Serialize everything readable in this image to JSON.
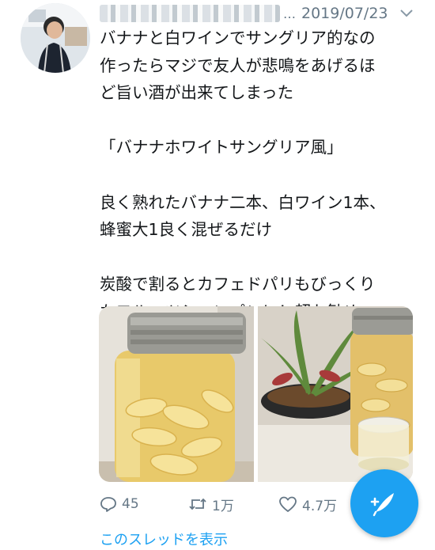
{
  "tweet": {
    "date": "2019/07/23",
    "header_more": "…",
    "text": "バナナと白ワインでサングリア的なの\n作ったらマジで友人が悲鳴をあげるほ\nど旨い酒が出来てしまった\n\n「バナナホワイトサングリア風」\n\n良く熟れたバナナ二本、白ワイン1本、\n蜂蜜大1良く混ぜるだけ\n\n炭酸で割るとカフェドパリもびっくり\nなフルーツシャンパンに！超お勧め"
  },
  "actions": {
    "reply_count": "45",
    "retweet_count": "1万",
    "like_count": "4.7万"
  },
  "thread_link": "このスレッドを表示",
  "icons": {
    "reply": "reply-icon",
    "retweet": "retweet-icon",
    "like": "heart-icon",
    "compose": "compose-tweet-icon",
    "menu": "chevron-down-icon"
  },
  "colors": {
    "accent": "#1da1f2",
    "muted": "#657786",
    "text": "#14171a"
  }
}
